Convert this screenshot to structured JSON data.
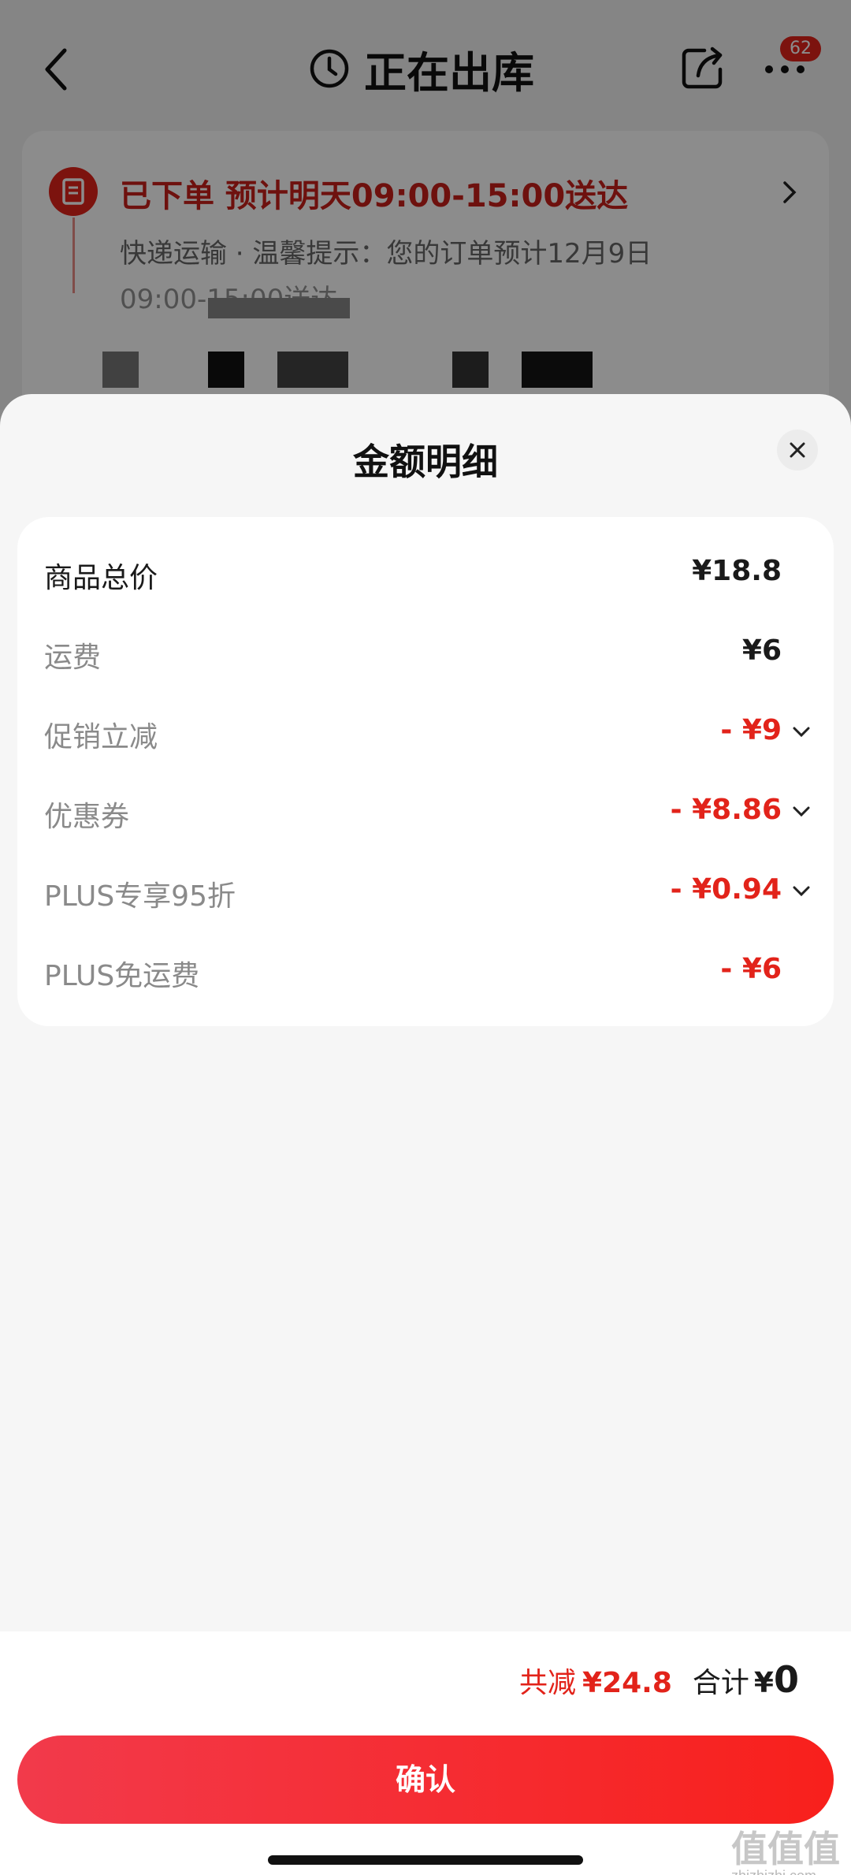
{
  "background": {
    "nav": {
      "title": "正在出库",
      "message_count": "62"
    },
    "order": {
      "status_line": "已下单  预计明天09:00-15:00送达",
      "detail_line1": "快递运输 · 温馨提示：您的订单预计12月9日",
      "detail_line2": "09:00-15:00送达"
    }
  },
  "sheet": {
    "title": "金额明细",
    "rows": [
      {
        "label": "商品总价",
        "value": "¥18.8"
      },
      {
        "label": "运费",
        "value": "¥6"
      },
      {
        "label": "促销立减",
        "value": "- ¥9"
      },
      {
        "label": "优惠券",
        "value": "- ¥8.86"
      },
      {
        "label": "PLUS专享95折",
        "value": "- ¥0.94"
      },
      {
        "label": "PLUS免运费",
        "value": "- ¥6"
      }
    ]
  },
  "footer": {
    "reduce_label": "共减",
    "reduce_value": "¥24.8",
    "total_label": "合计",
    "total_currency": "¥",
    "total_value": "0",
    "confirm_label": "确认"
  },
  "watermark": {
    "logo_text": "值值值",
    "site": "zhizhizhi.com"
  },
  "colors": {
    "accent_red": "#e2231a",
    "confirm_gradient": [
      "#f23a4b",
      "#f8201c"
    ]
  }
}
